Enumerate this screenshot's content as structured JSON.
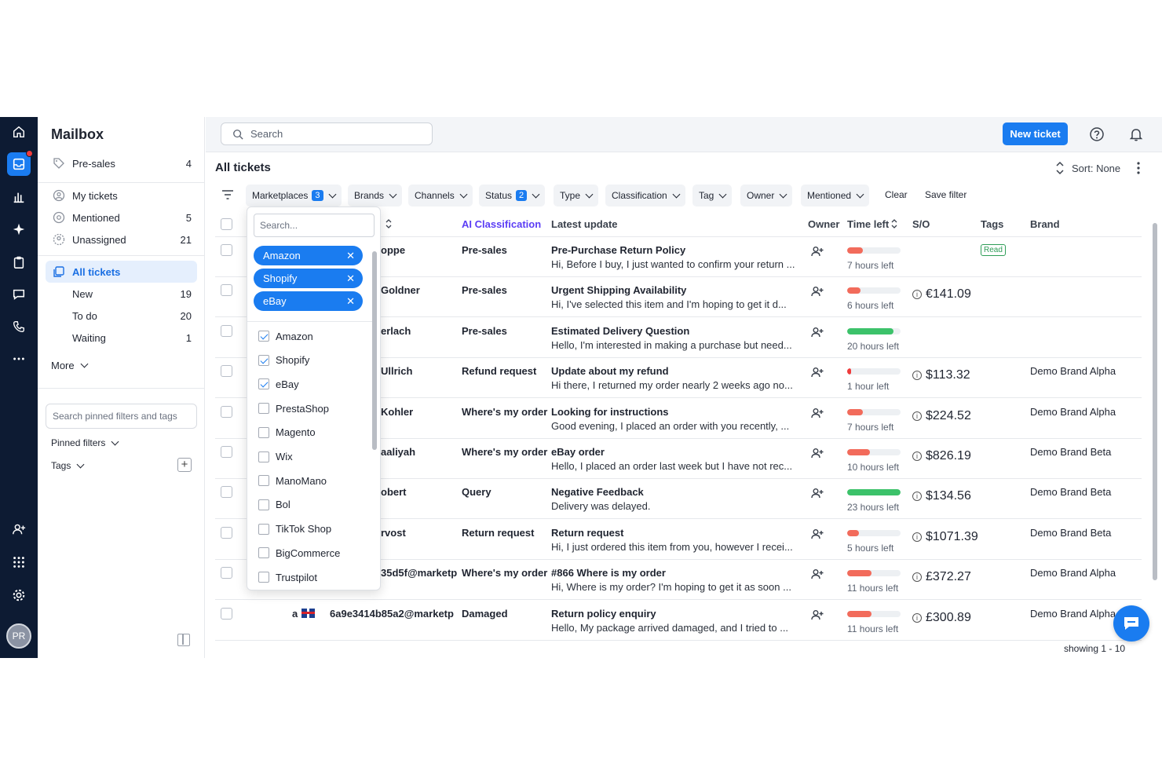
{
  "sidebar": {
    "title": "Mailbox",
    "presales": {
      "label": "Pre-sales",
      "count": "4"
    },
    "my_tickets": {
      "label": "My tickets"
    },
    "mentioned": {
      "label": "Mentioned",
      "count": "5"
    },
    "unassigned": {
      "label": "Unassigned",
      "count": "21"
    },
    "all_tickets": {
      "label": "All tickets"
    },
    "sub": [
      {
        "label": "New",
        "count": "19"
      },
      {
        "label": "To do",
        "count": "20"
      },
      {
        "label": "Waiting",
        "count": "1"
      }
    ],
    "more": "More",
    "pinned_search_placeholder": "Search pinned filters and tags",
    "pinned_filters": "Pinned filters",
    "tags": "Tags"
  },
  "rail": {
    "avatar": "PR"
  },
  "topbar": {
    "search_placeholder": "Search",
    "new_ticket": "New ticket"
  },
  "heading": "All tickets",
  "sort_label": "Sort: None",
  "filters": {
    "marketplaces": {
      "label": "Marketplaces",
      "badge": "3"
    },
    "brands": "Brands",
    "channels": "Channels",
    "status": {
      "label": "Status",
      "badge": "2"
    },
    "type": "Type",
    "classification": "Classification",
    "tag": "Tag",
    "owner": "Owner",
    "mentioned": "Mentioned",
    "clear": "Clear",
    "save": "Save filter"
  },
  "columns": {
    "ai_classification": "AI Classification",
    "latest_update": "Latest update",
    "owner": "Owner",
    "time_left": "Time left",
    "so": "S/O",
    "tags": "Tags",
    "brand": "Brand"
  },
  "rows": [
    {
      "customer": "oppe",
      "classification": "Pre-sales",
      "subject": "Pre-Purchase Return Policy",
      "preview": "Hi, Before I buy, I just wanted to confirm your return ...",
      "time_left": "7 hours left",
      "progress": 0.3,
      "bar_color": "#f26b5b",
      "so": "",
      "tag": "Read",
      "brand": ""
    },
    {
      "customer": "Goldner",
      "classification": "Pre-sales",
      "subject": "Urgent Shipping Availability",
      "preview": "Hi, I've selected this item and I'm hoping to get it d...",
      "time_left": "6 hours left",
      "progress": 0.25,
      "bar_color": "#f26b5b",
      "so": "€141.09",
      "tag": "",
      "brand": ""
    },
    {
      "customer": "erlach",
      "classification": "Pre-sales",
      "subject": "Estimated Delivery Question",
      "preview": "Hello, I'm interested in making a purchase but need...",
      "time_left": "20 hours left",
      "progress": 0.87,
      "bar_color": "#3cc26a",
      "so": "",
      "tag": "",
      "brand": ""
    },
    {
      "customer": "Ullrich",
      "classification": "Refund request",
      "subject": "Update about my refund",
      "preview": "Hi there, I returned my order nearly 2 weeks ago no...",
      "time_left": "1 hour left",
      "progress": 0.08,
      "bar_color": "#ef3b3b",
      "so": "$113.32",
      "tag": "",
      "brand": "Demo Brand Alpha"
    },
    {
      "customer": "Kohler",
      "classification": "Where's my order",
      "subject": "Looking for instructions",
      "preview": "Good evening, I placed an order with you recently, ...",
      "time_left": "7 hours left",
      "progress": 0.3,
      "bar_color": "#f26b5b",
      "so": "$224.52",
      "tag": "",
      "brand": "Demo Brand Alpha"
    },
    {
      "customer": "aaliyah",
      "classification": "Where's my order",
      "subject": "eBay order",
      "preview": "Hello, I placed an order last week but I have not rec...",
      "time_left": "10 hours left",
      "progress": 0.42,
      "bar_color": "#f26b5b",
      "so": "$826.19",
      "tag": "",
      "brand": "Demo Brand Beta"
    },
    {
      "customer": "obert",
      "classification": "Query",
      "subject": "Negative Feedback",
      "preview": "Delivery was delayed.",
      "time_left": "23 hours left",
      "progress": 1.0,
      "bar_color": "#3cc26a",
      "so": "$134.56",
      "tag": "",
      "brand": "Demo Brand Beta"
    },
    {
      "customer": "rvost",
      "classification": "Return request",
      "subject": "Return request",
      "preview": "Hi, I just ordered this item from you, however I recei...",
      "time_left": "5 hours left",
      "progress": 0.22,
      "bar_color": "#f26b5b",
      "so": "$1071.39",
      "tag": "",
      "brand": "Demo Brand Beta"
    },
    {
      "customer": "35d5f@marketp",
      "classification": "Where's my order",
      "subject": "#866 Where is my order",
      "preview": "Hi, Where is my order? I'm hoping to get it as soon ...",
      "time_left": "11 hours left",
      "progress": 0.45,
      "bar_color": "#f26b5b",
      "so": "£372.27",
      "tag": "",
      "brand": "Demo Brand Alpha"
    },
    {
      "customer": "6a9e3414b85a2@marketp",
      "marketplace": "a",
      "classification": "Damaged",
      "subject": "Return policy enquiry",
      "preview": "Hello, My package arrived damaged, and I tried to ...",
      "time_left": "11 hours left",
      "progress": 0.45,
      "bar_color": "#f26b5b",
      "so": "£300.89",
      "tag": "",
      "brand": "Demo Brand Alpha"
    }
  ],
  "showing": "showing 1 - 10",
  "dropdown": {
    "search_placeholder": "Search...",
    "selected": [
      "Amazon",
      "Shopify",
      "eBay"
    ],
    "options": [
      {
        "label": "Amazon",
        "checked": true
      },
      {
        "label": "Shopify",
        "checked": true
      },
      {
        "label": "eBay",
        "checked": true
      },
      {
        "label": "PrestaShop",
        "checked": false
      },
      {
        "label": "Magento",
        "checked": false
      },
      {
        "label": "Wix",
        "checked": false
      },
      {
        "label": "ManoMano",
        "checked": false
      },
      {
        "label": "Bol",
        "checked": false
      },
      {
        "label": "TikTok Shop",
        "checked": false
      },
      {
        "label": "BigCommerce",
        "checked": false
      },
      {
        "label": "Trustpilot",
        "checked": false
      }
    ]
  },
  "colors": {
    "accent": "#1a7cf0",
    "rail": "#0d1b33",
    "ai": "#5b3df5"
  }
}
